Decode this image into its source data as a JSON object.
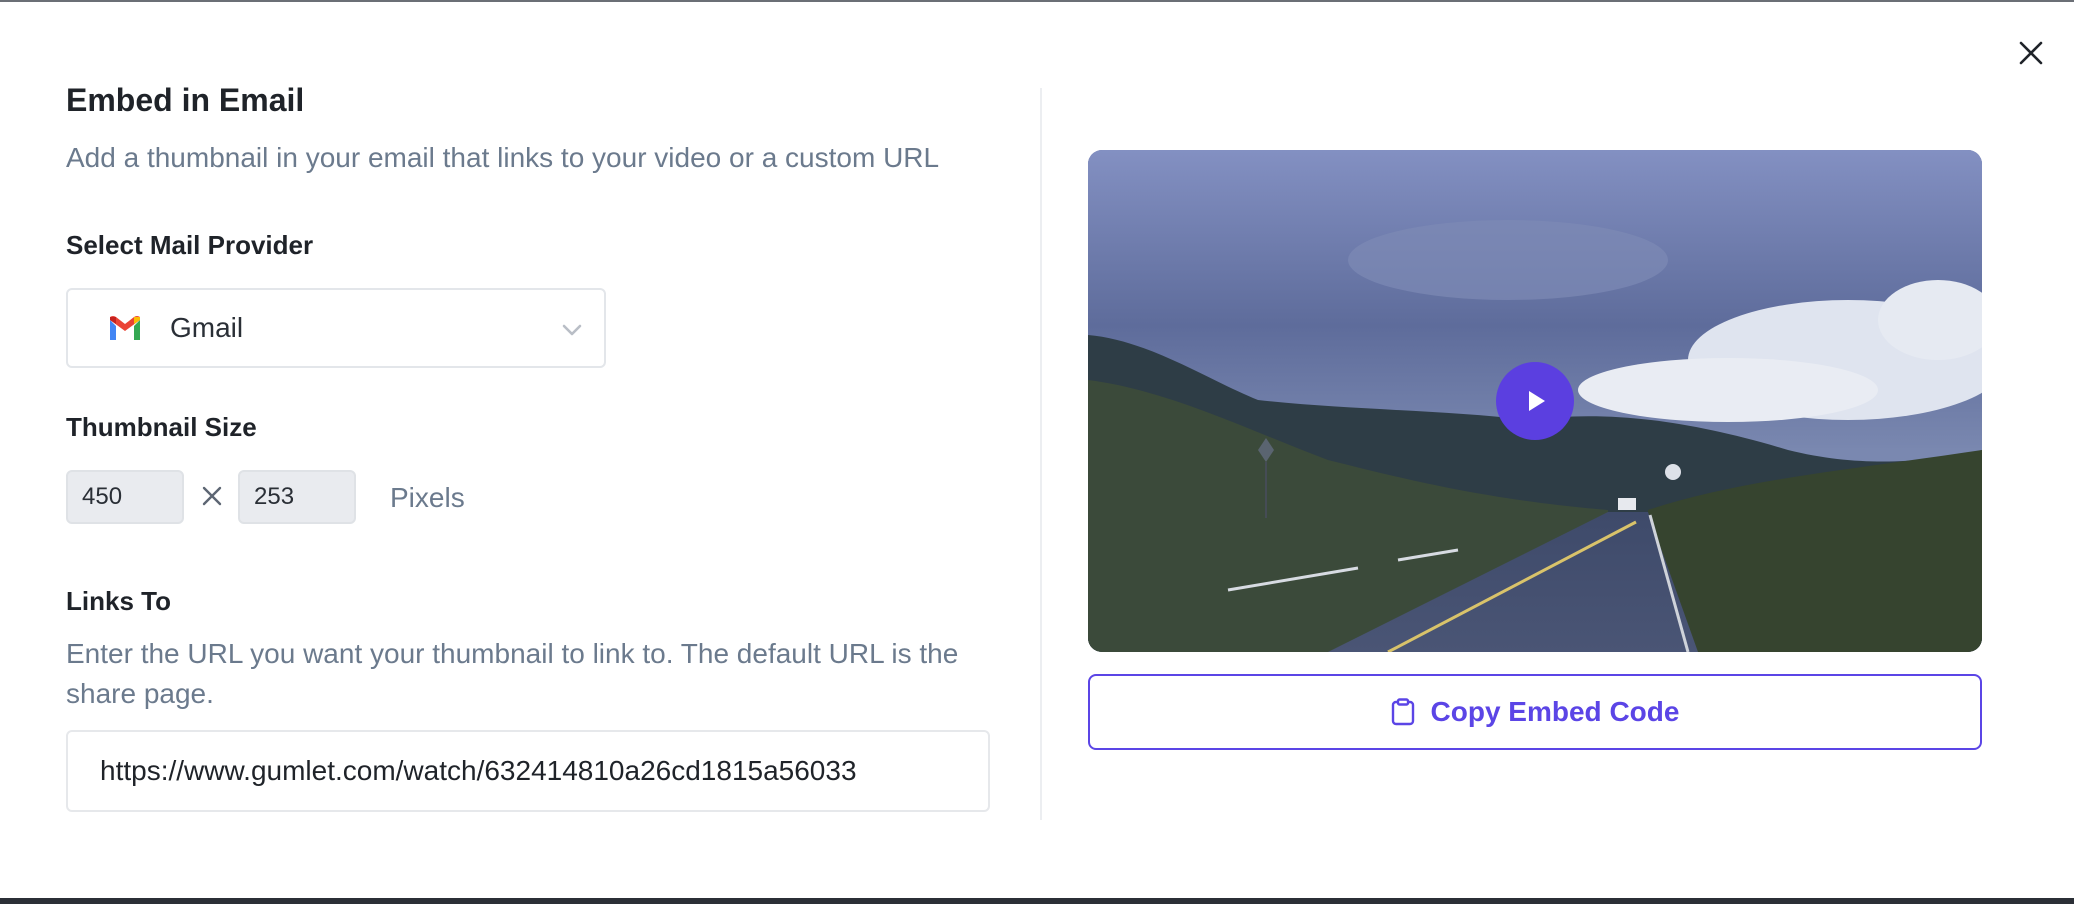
{
  "modal": {
    "title": "Embed in Email",
    "subtitle": "Add a thumbnail in your email that links to your video or a custom URL",
    "close_icon": "close-icon"
  },
  "mail_provider": {
    "label": "Select Mail Provider",
    "selected": "Gmail",
    "icon": "gmail-icon"
  },
  "thumbnail_size": {
    "label": "Thumbnail Size",
    "width": "450",
    "height": "253",
    "unit": "Pixels"
  },
  "links_to": {
    "label": "Links To",
    "help": "Enter the URL you want your thumbnail to link to. The default URL is the share page.",
    "url": "https://www.gumlet.com/watch/632414810a26cd1815a56033"
  },
  "preview": {
    "play_icon": "play-icon"
  },
  "copy_button": {
    "label": "Copy Embed Code",
    "icon": "clipboard-icon"
  },
  "colors": {
    "accent": "#5b45e6",
    "play": "#5b3fe0",
    "muted_text": "#6b7a8d",
    "heading": "#1f2329"
  }
}
